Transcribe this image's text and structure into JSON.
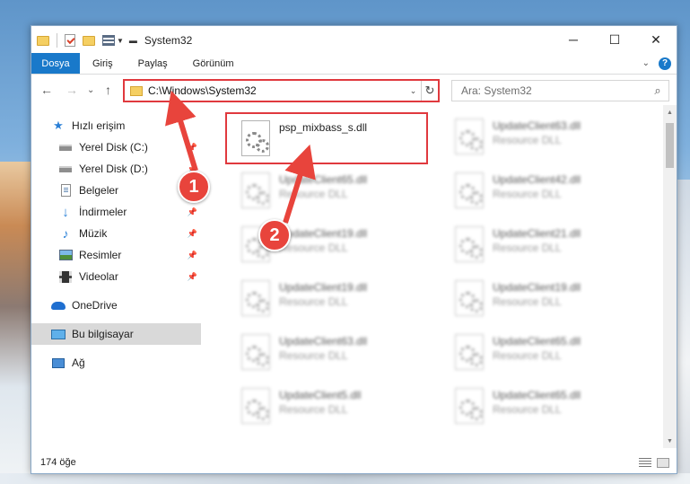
{
  "window": {
    "title": "System32",
    "controls": {
      "minimize": "─",
      "maximize": "☐",
      "close": "✕"
    }
  },
  "ribbon": {
    "tabs": [
      "Dosya",
      "Giriş",
      "Paylaş",
      "Görünüm"
    ],
    "help": "?"
  },
  "address_bar": {
    "path": "C:\\Windows\\System32",
    "dropdown": "⌄",
    "refresh": "↻"
  },
  "search": {
    "placeholder": "Ara: System32"
  },
  "nav": {
    "back": "←",
    "forward": "→",
    "recent": "⌄",
    "up": "↑"
  },
  "sidebar": {
    "items": [
      {
        "label": "Hızlı erişim",
        "icon": "star-icon"
      },
      {
        "label": "Yerel Disk (C:)",
        "icon": "disk-icon",
        "pinned": true
      },
      {
        "label": "Yerel Disk (D:)",
        "icon": "disk-icon",
        "pinned": true
      },
      {
        "label": "Belgeler",
        "icon": "documents-icon",
        "pinned": true
      },
      {
        "label": "İndirmeler",
        "icon": "downloads-icon",
        "pinned": true
      },
      {
        "label": "Müzik",
        "icon": "music-icon",
        "pinned": true
      },
      {
        "label": "Resimler",
        "icon": "pictures-icon",
        "pinned": true
      },
      {
        "label": "Videolar",
        "icon": "videos-icon",
        "pinned": true
      },
      {
        "label": "OneDrive",
        "icon": "onedrive-icon"
      },
      {
        "label": "Bu bilgisayar",
        "icon": "computer-icon",
        "selected": true
      },
      {
        "label": "Ağ",
        "icon": "network-icon"
      }
    ]
  },
  "files": [
    {
      "name": "psp_mixbass_s.dll",
      "type": "",
      "highlighted": true
    },
    {
      "name": "UpdateClient63.dll",
      "type": "Resource DLL"
    },
    {
      "name": "UpdateClient65.dll",
      "type": "Resource DLL"
    },
    {
      "name": "UpdateClient42.dll",
      "type": "Resource DLL"
    },
    {
      "name": "UpdateClient19.dll",
      "type": "Resource DLL"
    },
    {
      "name": "UpdateClient21.dll",
      "type": "Resource DLL"
    },
    {
      "name": "UpdateClient19.dll",
      "type": "Resource DLL"
    },
    {
      "name": "UpdateClient19.dll",
      "type": "Resource DLL"
    },
    {
      "name": "UpdateClient63.dll",
      "type": "Resource DLL"
    },
    {
      "name": "UpdateClient65.dll",
      "type": "Resource DLL"
    },
    {
      "name": "UpdateClient5.dll",
      "type": "Resource DLL"
    },
    {
      "name": "UpdateClient65.dll",
      "type": "Resource DLL"
    }
  ],
  "status": {
    "count": "174 öğe"
  },
  "annotations": {
    "step1": "1",
    "step2": "2",
    "accent": "#e0393e"
  }
}
